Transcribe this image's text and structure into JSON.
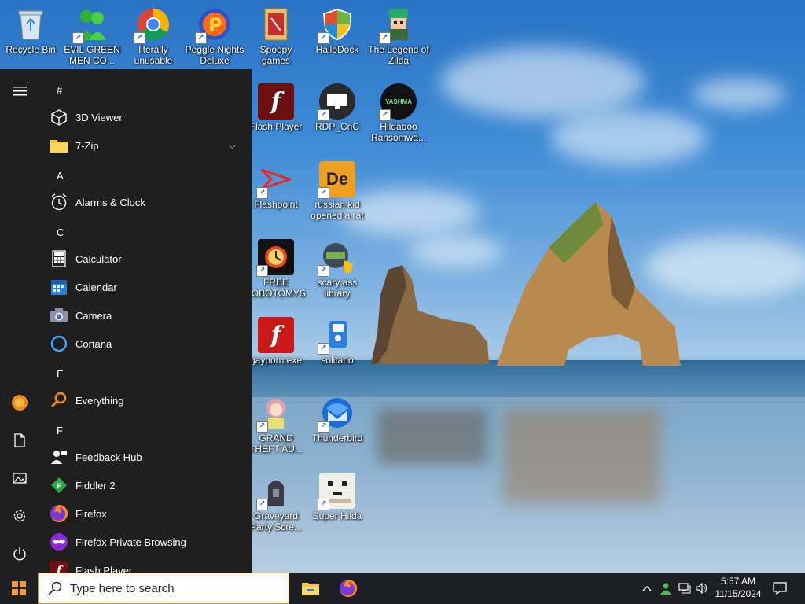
{
  "desktop": {
    "icons": [
      {
        "label": "Recycle Bin"
      },
      {
        "label": "EVIL GREEN MEN CO..."
      },
      {
        "label": "literally unusable"
      },
      {
        "label": "Peggle Nights Deluxe"
      },
      {
        "label": "Spoopy games"
      },
      {
        "label": "HalloDock"
      },
      {
        "label": "The Legend of Zilda"
      },
      {
        "label": "Flash Player"
      },
      {
        "label": "RDP_CnC"
      },
      {
        "label": "Hildaboo Ransomwa..."
      },
      {
        "label": "Flashpoint"
      },
      {
        "label": "russian kid opened a rat"
      },
      {
        "label": "FREE LOBOTOMYS"
      },
      {
        "label": "scary ass library"
      },
      {
        "label": "gayporn.exe"
      },
      {
        "label": "solitario"
      },
      {
        "label": "GRAND THEFT AU..."
      },
      {
        "label": "Thunderbird"
      },
      {
        "label": "Graveyard Party Scre..."
      },
      {
        "label": "Super Hilda"
      }
    ],
    "icon_text": {
      "yashma": "YASHMA",
      "de": "De"
    }
  },
  "start_menu": {
    "headers": [
      "#",
      "A",
      "C",
      "E",
      "F"
    ],
    "apps": [
      {
        "label": "3D Viewer"
      },
      {
        "label": "7-Zip"
      },
      {
        "label": "Alarms & Clock"
      },
      {
        "label": "Calculator"
      },
      {
        "label": "Calendar"
      },
      {
        "label": "Camera"
      },
      {
        "label": "Cortana"
      },
      {
        "label": "Everything"
      },
      {
        "label": "Feedback Hub"
      },
      {
        "label": "Fiddler 2"
      },
      {
        "label": "Firefox"
      },
      {
        "label": "Firefox Private Browsing"
      },
      {
        "label": "Flash Player"
      }
    ],
    "rail_icons": [
      "hamburger-icon",
      "user-avatar-icon",
      "documents-icon",
      "pictures-icon",
      "settings-icon",
      "power-icon"
    ]
  },
  "taskbar": {
    "search_placeholder": "Type here to search",
    "time": "5:57 AM",
    "date": "11/15/2024"
  },
  "colors": {
    "start_menu_bg": "#1f1f1f",
    "taskbar_bg": "#1e1f24",
    "search_border": "#e08a1c"
  }
}
